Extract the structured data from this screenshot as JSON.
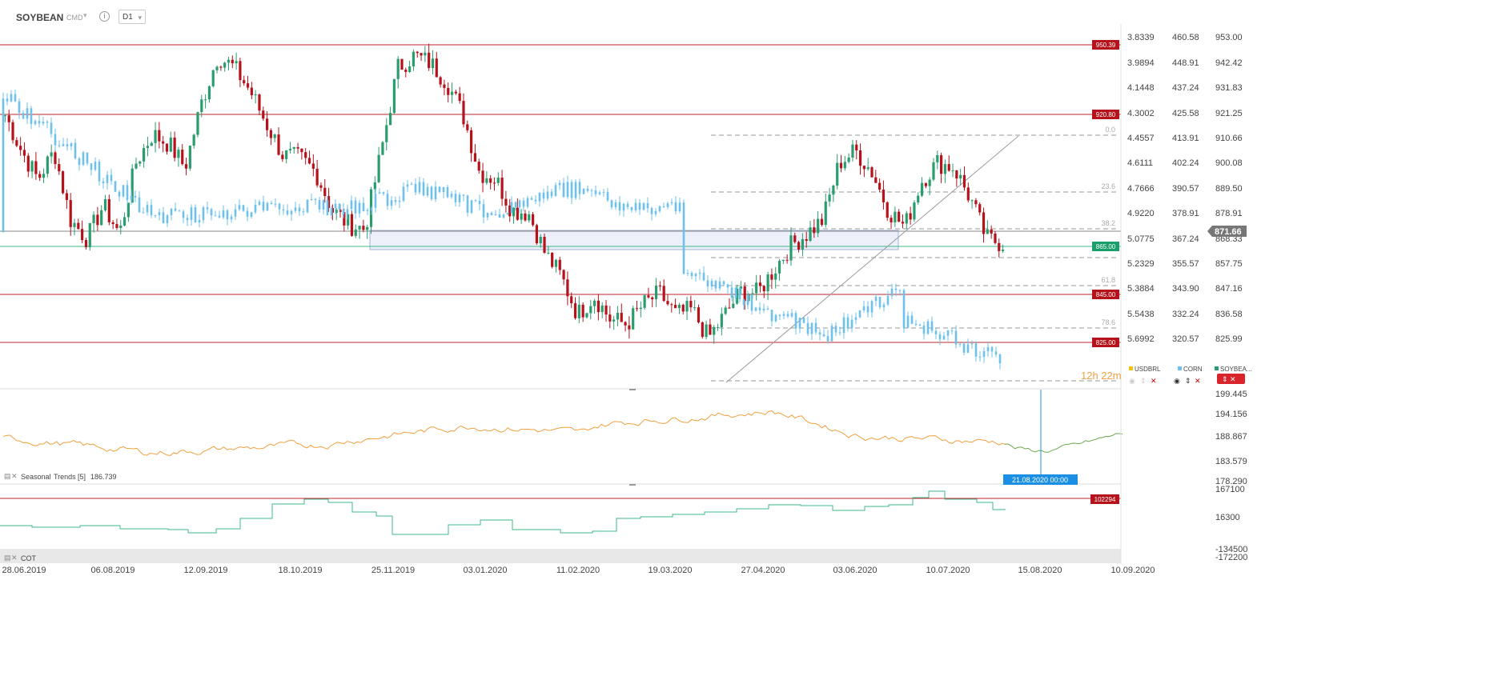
{
  "header": {
    "symbol": "SOYBEAN",
    "type": "CMD",
    "timeframe": "D1",
    "caret": "▾",
    "info": "i"
  },
  "colors": {
    "bull": "#2a9d6e",
    "bear": "#b5121b",
    "blue": "#6ec1ea",
    "orange": "#f0a040",
    "green": "#6aa84f",
    "level": "#c0272d",
    "teal": "#3cb88a"
  },
  "price_axis": {
    "col1": [
      "3.8339",
      "3.9894",
      "4.1448",
      "4.3002",
      "4.4557",
      "4.6111",
      "4.7666",
      "4.9220",
      "5.0775",
      "5.2329",
      "5.3884",
      "5.5438",
      "5.6992"
    ],
    "col2": [
      "460.58",
      "448.91",
      "437.24",
      "425.58",
      "413.91",
      "402.24",
      "390.57",
      "378.91",
      "367.24",
      "355.57",
      "343.90",
      "332.24",
      "320.57"
    ],
    "col3": [
      "953.00",
      "942.42",
      "931.83",
      "921.25",
      "910.66",
      "900.08",
      "889.50",
      "878.91",
      "868.33",
      "857.75",
      "847.16",
      "836.58",
      "825.99"
    ]
  },
  "levels": [
    "950.39",
    "920.80",
    "865.00",
    "845.00",
    "825.00"
  ],
  "current_price": "871.66",
  "fib_labels": [
    "0.0",
    "23.6",
    "38.2",
    "61.8",
    "78.6"
  ],
  "countdown": "12h 22m",
  "legend": {
    "items": [
      "USDBRL",
      "CORN",
      "SOYBEA..."
    ]
  },
  "seasonal": {
    "label": "Seasonal",
    "name": "Trends",
    "period": "[5]",
    "value": "186.739",
    "axis": [
      "199.445",
      "194.156",
      "188.867",
      "183.579",
      "178.290"
    ],
    "crosshair_label": "21.08.2020 00:00"
  },
  "cot": {
    "label": "COT",
    "axis": [
      "167100",
      "16300",
      "-134500",
      "-172200"
    ],
    "level": "102294"
  },
  "x_axis": [
    "28.06.2019",
    "06.08.2019",
    "12.09.2019",
    "18.10.2019",
    "25.11.2019",
    "03.01.2020",
    "11.02.2020",
    "19.03.2020",
    "27.04.2020",
    "03.06.2020",
    "10.07.2020",
    "15.08.2020",
    "10.09.2020"
  ],
  "chart_data": [
    {
      "type": "candlestick",
      "title": "SOYBEAN",
      "ylim": [
        822,
        956
      ],
      "horizontal_levels": [
        950.39,
        920.8,
        865.0,
        845.0,
        825.0
      ],
      "current_price": 871.66,
      "fibonacci": {
        "0.0": 910.9,
        "23.6": 888.9,
        "38.2": 874.8,
        "61.8": 849.7,
        "78.6": 835.3
      },
      "approx_closes": [
        920,
        905,
        893,
        905,
        876,
        868,
        882,
        870,
        900,
        912,
        908,
        898,
        925,
        945,
        940,
        930,
        916,
        903,
        902,
        896,
        880,
        874,
        872,
        905,
        940,
        945,
        942,
        934,
        920,
        896,
        893,
        880,
        879,
        862,
        852,
        836,
        844,
        834,
        832,
        840,
        845,
        836,
        838,
        826,
        836,
        846,
        845,
        855,
        865,
        870,
        876,
        900,
        905,
        896,
        880,
        873,
        892,
        900,
        898,
        885,
        868,
        866
      ]
    },
    {
      "type": "line",
      "title": "Seasonal Trends [5]",
      "ylim": [
        178.29,
        199.445
      ],
      "last_value": 186.739
    },
    {
      "type": "line",
      "title": "COT",
      "ylim": [
        -172200,
        167100
      ],
      "level": 102294
    }
  ]
}
